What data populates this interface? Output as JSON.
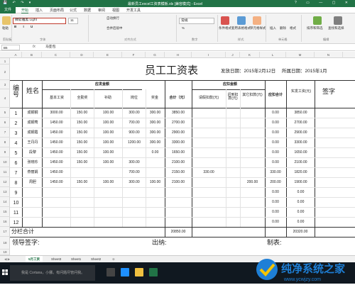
{
  "window": {
    "title": "最新员工excel工资表模板.xls [兼容模式] - Excel",
    "quick_access": "💾 ↶ ↷ ▾",
    "controls": "? ▭ — ▢ ✕"
  },
  "menu": {
    "file": "文件",
    "tabs": [
      "开始",
      "插入",
      "页面布局",
      "公式",
      "数据",
      "审阅",
      "视图",
      "开发工具"
    ],
    "active": "开始"
  },
  "ribbon": {
    "clipboard": {
      "paste": "粘贴",
      "group": "剪贴板"
    },
    "font": {
      "name": "微软雅黑 Light",
      "size": "11",
      "group": "字体"
    },
    "align": {
      "wrap": "自动换行",
      "merge": "合并后居中",
      "group": "对齐方式"
    },
    "number": {
      "format": "常规",
      "pct": "%",
      "group": "数字"
    },
    "styles": {
      "cond": "条件格式",
      "table": "套用表格格式",
      "cell": "单元格样式",
      "group": "样式"
    },
    "cells": {
      "insert": "插入",
      "delete": "删除",
      "format": "格式",
      "group": "单元格"
    },
    "edit": {
      "sort": "排序和筛选",
      "find": "查找和选择",
      "group": "编辑"
    }
  },
  "formula_bar": {
    "name_box": "B5",
    "fx": "fx",
    "content": "马亚包"
  },
  "columns": [
    "A",
    "B",
    "C",
    "D",
    "E",
    "F",
    "G",
    "H",
    "I",
    "J",
    "K",
    "L",
    "M",
    "N"
  ],
  "rows": [
    "1",
    "2",
    "3",
    "4",
    "5",
    "6",
    "7",
    "8",
    "9",
    "10",
    "11",
    "12",
    "13",
    "14",
    "15",
    "16",
    "17",
    "18",
    "19",
    "20",
    "21"
  ],
  "sheet": {
    "title": "员工工资表",
    "issue_date": "发放日期：2015年2月12日",
    "period": "所属日期：2015年1月",
    "hdr_no": "编号",
    "hdr_name": "姓名",
    "hdr_payable": "应发金额",
    "hdr_deduct": "应扣金额",
    "hdr_net": "实发工资(元)",
    "hdr_sign": "签字",
    "sub": {
      "base": "基本工资",
      "attendance": "全勤奖",
      "subsidy": "补助",
      "post": "岗位",
      "bonus": "奖金",
      "total": "合计（元）",
      "leave": "请假扣款(元)",
      "late": "迟到扣款(元)",
      "other": "其它扣款(元)",
      "deduct_total": "应扣合计"
    },
    "employees": [
      {
        "no": "1",
        "name": "成钢钢",
        "base": "3000.00",
        "att": "150.00",
        "sub": "100.00",
        "post": "300.00",
        "bonus": "300.00",
        "total": "3850.00",
        "leave": "",
        "late": "",
        "other": "",
        "dtotal": "0.00",
        "net": "3850.00"
      },
      {
        "no": "2",
        "name": "成钢莺",
        "base": "1450.00",
        "att": "150.00",
        "sub": "100.00",
        "post": "700.00",
        "bonus": "300.00",
        "total": "2700.00",
        "leave": "",
        "late": "",
        "other": "",
        "dtotal": "0.00",
        "net": "2700.00"
      },
      {
        "no": "3",
        "name": "成钢霞",
        "base": "1450.00",
        "att": "150.00",
        "sub": "100.00",
        "post": "900.00",
        "bonus": "300.00",
        "total": "2900.00",
        "leave": "",
        "late": "",
        "other": "",
        "dtotal": "0.00",
        "net": "2900.00"
      },
      {
        "no": "4",
        "name": "王丹丹",
        "base": "1450.00",
        "att": "150.00",
        "sub": "100.00",
        "post": "1200.00",
        "bonus": "300.00",
        "total": "3300.00",
        "leave": "",
        "late": "",
        "other": "",
        "dtotal": "0.00",
        "net": "3300.00"
      },
      {
        "no": "5",
        "name": "段黎",
        "base": "1450.00",
        "att": "150.00",
        "sub": "100.00",
        "post": "",
        "bonus": "0.00",
        "total": "1650.00",
        "leave": "",
        "late": "",
        "other": "",
        "dtotal": "0.00",
        "net": "1650.00"
      },
      {
        "no": "6",
        "name": "张晓珍",
        "base": "1450.00",
        "att": "150.00",
        "sub": "100.00",
        "post": "300.00",
        "bonus": "",
        "total": "2100.00",
        "leave": "",
        "late": "",
        "other": "",
        "dtotal": "0.00",
        "net": "2100.00"
      },
      {
        "no": "7",
        "name": "燕丽娟",
        "base": "1450.00",
        "att": "",
        "sub": "",
        "post": "700.00",
        "bonus": "",
        "total": "2150.00",
        "leave": "330.00",
        "late": "",
        "other": "",
        "dtotal": "330.00",
        "net": "1820.00"
      },
      {
        "no": "8",
        "name": "周胆",
        "base": "1450.00",
        "att": "150.00",
        "sub": "100.00",
        "post": "300.00",
        "bonus": "100.00",
        "total": "2100.00",
        "leave": "",
        "late": "",
        "other": "200.00",
        "dtotal": "200.00",
        "net": "1900.00"
      },
      {
        "no": "9",
        "name": "",
        "base": "",
        "att": "",
        "sub": "",
        "post": "",
        "bonus": "",
        "total": "",
        "leave": "",
        "late": "",
        "other": "",
        "dtotal": "0.00",
        "net": "0.00"
      },
      {
        "no": "10",
        "name": "",
        "base": "",
        "att": "",
        "sub": "",
        "post": "",
        "bonus": "",
        "total": "",
        "leave": "",
        "late": "",
        "other": "",
        "dtotal": "0.00",
        "net": "0.00"
      },
      {
        "no": "11",
        "name": "",
        "base": "",
        "att": "",
        "sub": "",
        "post": "",
        "bonus": "",
        "total": "",
        "leave": "",
        "late": "",
        "other": "",
        "dtotal": "0.00",
        "net": "0.00"
      },
      {
        "no": "12",
        "name": "",
        "base": "",
        "att": "",
        "sub": "",
        "post": "",
        "bonus": "",
        "total": "",
        "leave": "",
        "late": "",
        "other": "",
        "dtotal": "0.00",
        "net": "0.00"
      }
    ],
    "sum_label": "分栏合计",
    "sum_total": "20850.00",
    "sum_net": "20320.00",
    "leader_sign": "领导签字:",
    "cashier": "出纳:",
    "maker": "制表:"
  },
  "sheet_tabs": [
    "5月工资",
    "Sheet3",
    "Sheet1",
    "Sheet2"
  ],
  "active_sheet": "5月工资",
  "taskbar": {
    "search": "我是 Cortana，小娜。有问题尽管问我。"
  },
  "watermark": {
    "text": "纯净系统之家",
    "url": "www.ycwjzy.com"
  },
  "colors": {
    "excel_green": "#217346",
    "accent_red": "#c0392b",
    "watermark_blue": "#1e7fd6"
  }
}
